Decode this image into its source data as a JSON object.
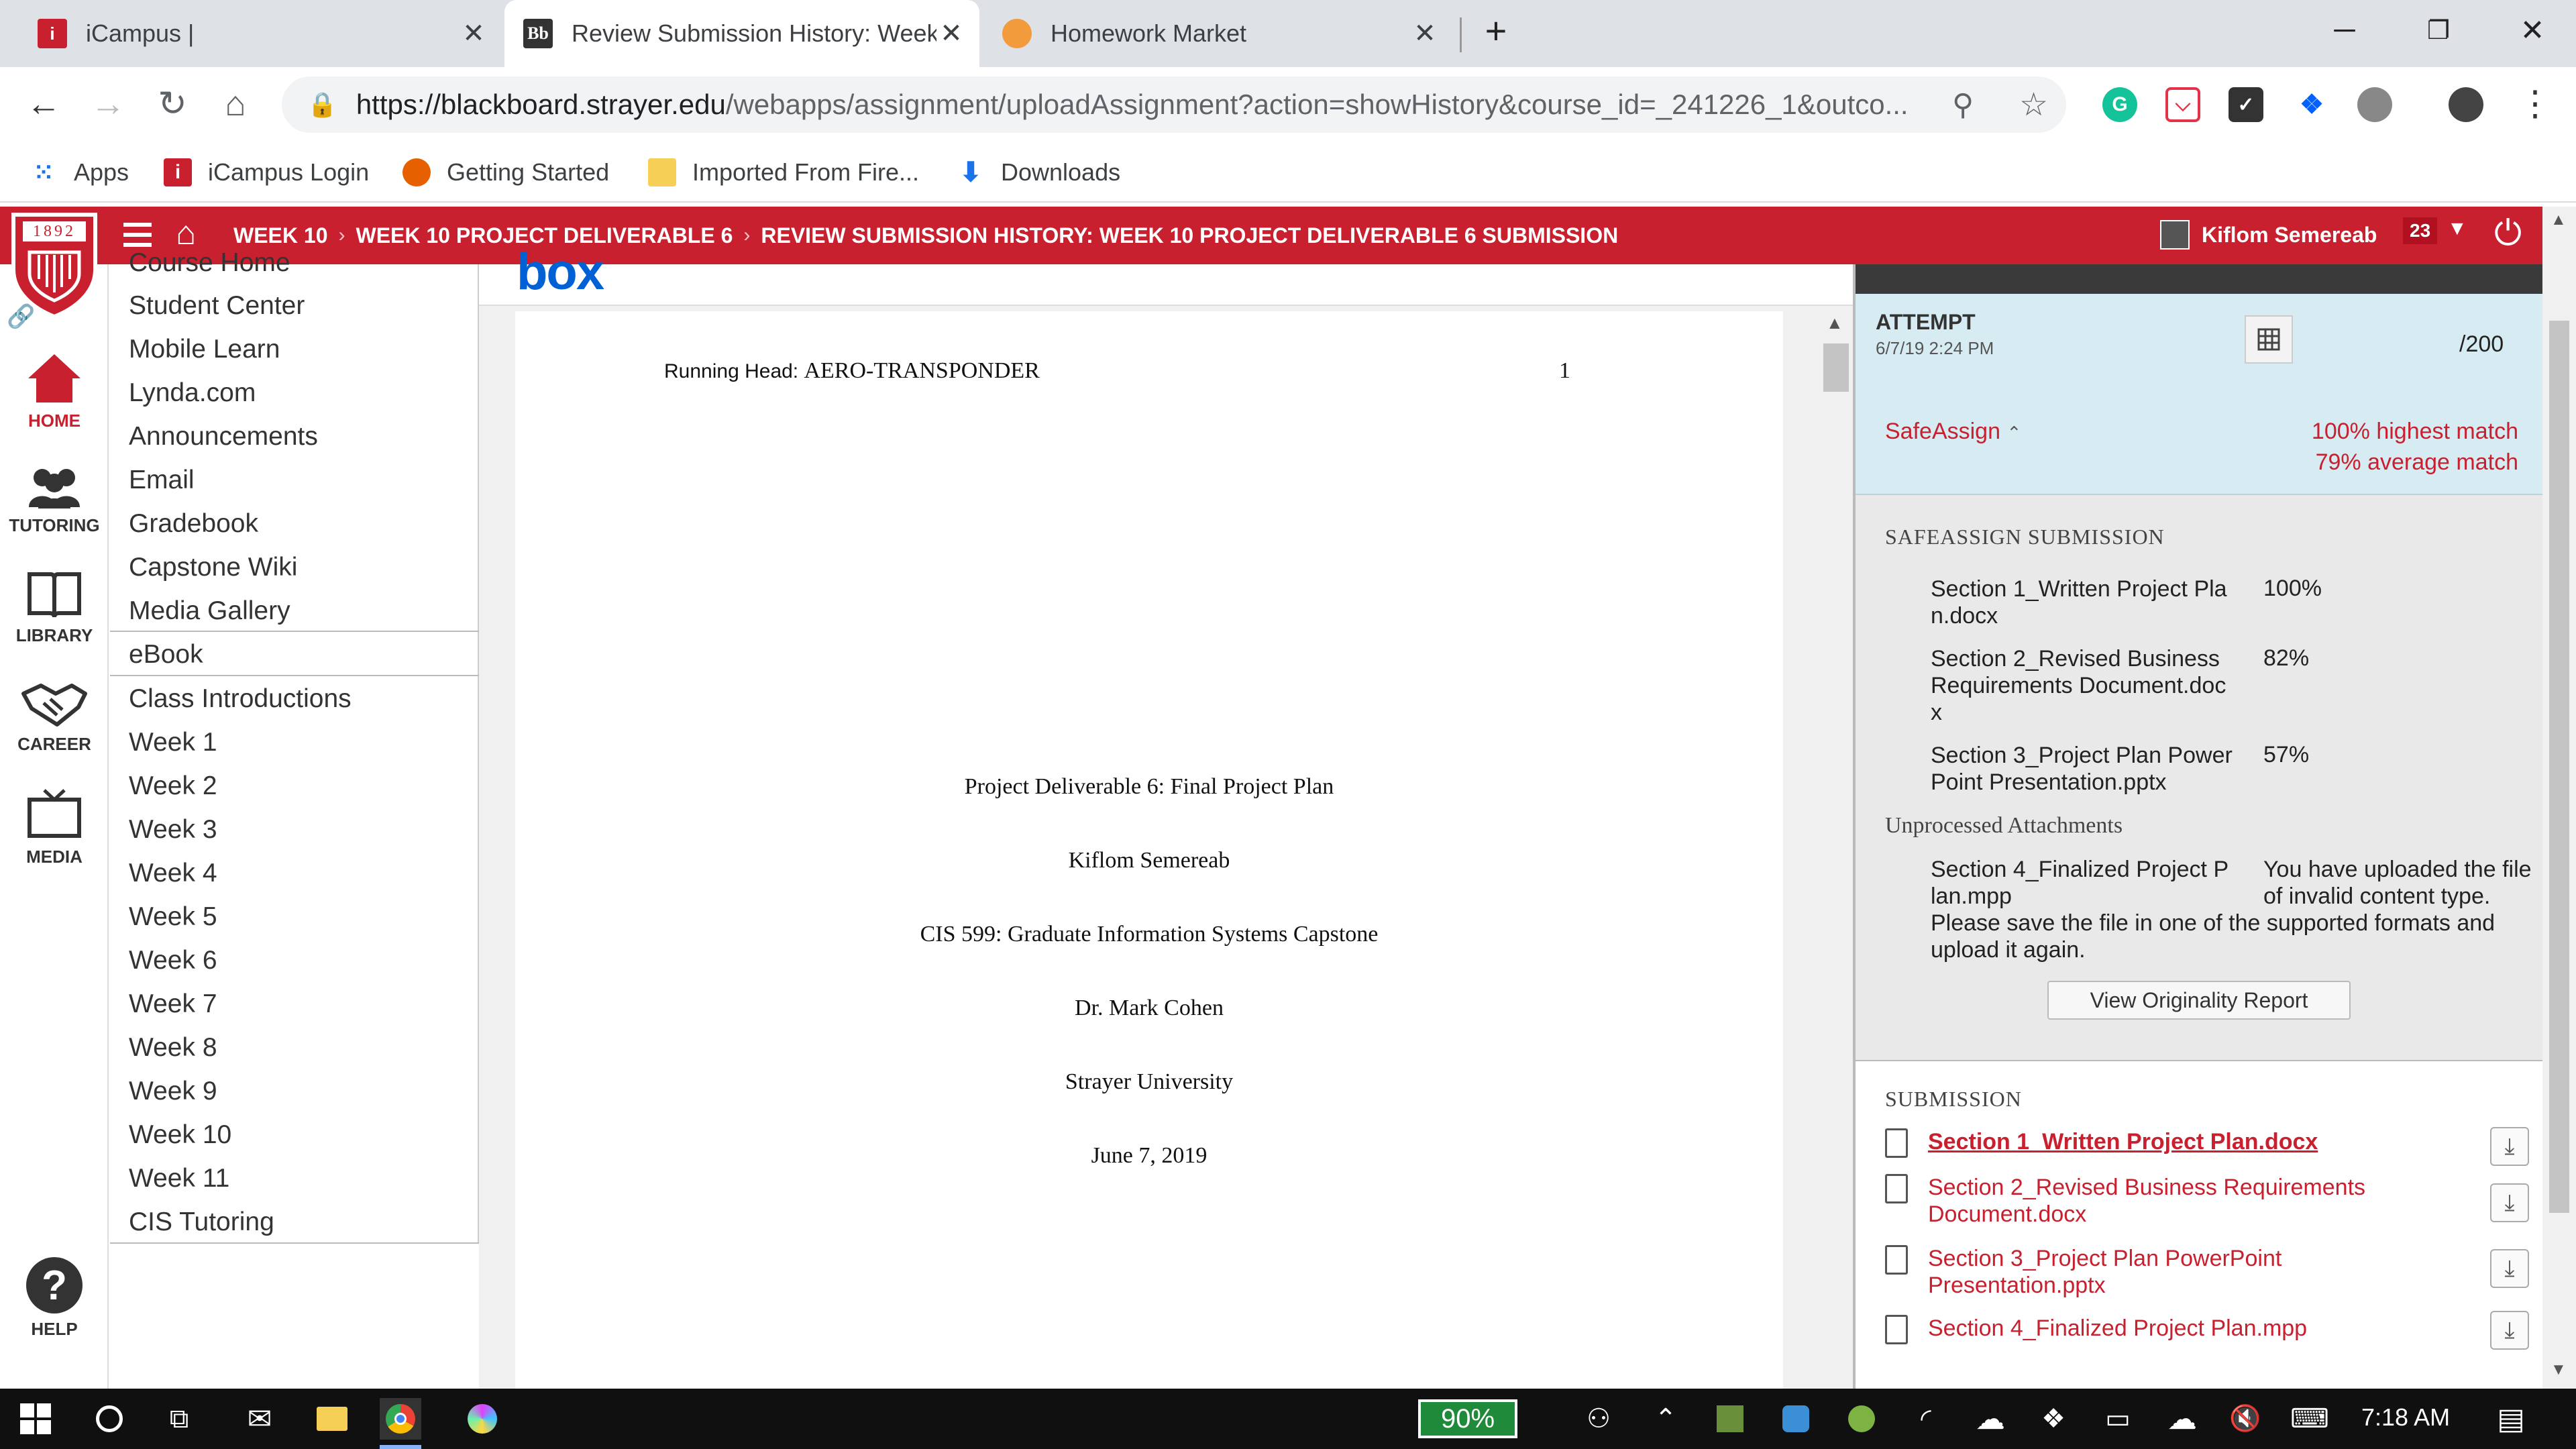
{
  "browser": {
    "tabs": [
      {
        "title": "iCampus |",
        "favicon": "icampus-icon"
      },
      {
        "title": "Review Submission History: Week",
        "favicon": "blackboard-icon",
        "active": true
      },
      {
        "title": "Homework Market",
        "favicon": "homework-market-icon"
      }
    ],
    "url_host": "https://blackboard.strayer.edu",
    "url_path": "/webapps/assignment/uploadAssignment?action=showHistory&course_id=_241226_1&outco...",
    "extension_badge": "1",
    "bookmarks": [
      {
        "label": "Apps",
        "icon": "apps-grid-icon"
      },
      {
        "label": "iCampus Login",
        "icon": "icampus-icon"
      },
      {
        "label": "Getting Started",
        "icon": "firefox-icon"
      },
      {
        "label": "Imported From Fire...",
        "icon": "folder-icon"
      },
      {
        "label": "Downloads",
        "icon": "download-icon"
      }
    ]
  },
  "header": {
    "logo_year": "1892",
    "breadcrumbs": [
      "WEEK 10",
      "WEEK 10 PROJECT DELIVERABLE 6",
      "REVIEW SUBMISSION HISTORY: WEEK 10 PROJECT DELIVERABLE 6 SUBMISSION"
    ],
    "user_name": "Kiflom Semereab",
    "notification_count": "23",
    "accent": "#c8202e"
  },
  "rail": [
    {
      "label": "HOME",
      "icon": "home-icon"
    },
    {
      "label": "TUTORING",
      "icon": "people-icon"
    },
    {
      "label": "LIBRARY",
      "icon": "book-icon"
    },
    {
      "label": "CAREER",
      "icon": "handshake-icon"
    },
    {
      "label": "MEDIA",
      "icon": "tv-icon"
    },
    {
      "label": "HELP",
      "icon": "help-icon"
    }
  ],
  "course_menu": {
    "partial_item": "Course Home",
    "items": [
      "Student Center",
      "Mobile Learn",
      "Lynda.com",
      "Announcements",
      "Email",
      "Gradebook",
      "Capstone Wiki",
      "Media Gallery",
      "eBook",
      "Class Introductions",
      "Week 1",
      "Week 2",
      "Week 3",
      "Week 4",
      "Week 5",
      "Week 6",
      "Week 7",
      "Week 8",
      "Week 9",
      "Week 10",
      "Week 11",
      "CIS Tutoring"
    ]
  },
  "document": {
    "viewer_logo": "box",
    "running_head": "Running Head: ",
    "running_head_title": "AERO-TRANSPONDER",
    "page_number": "1",
    "title": "Project Deliverable 6: Final Project Plan",
    "author": "Kiflom Semereab",
    "course": "CIS 599: Graduate Information Systems Capstone",
    "instructor": "Dr. Mark Cohen",
    "institution": "Strayer University",
    "date": "June 7, 2019"
  },
  "attempt": {
    "heading": "ATTEMPT",
    "datetime": "6/7/19 2:24 PM",
    "grade": "/200",
    "safeassign_label": "SafeAssign",
    "highest_match": "100% highest match",
    "average_match": "79% average match"
  },
  "safeassign": {
    "heading": "SAFEASSIGN SUBMISSION",
    "files": [
      {
        "name_line1": "Section 1_Written Project Pla",
        "name_line2": "n.docx",
        "name_line3": "",
        "pct": "100%"
      },
      {
        "name_line1": "Section 2_Revised Business",
        "name_line2": "Requirements Document.doc",
        "name_line3": "x",
        "pct": "82%"
      },
      {
        "name_line1": "Section 3_Project Plan Power",
        "name_line2": "Point Presentation.pptx",
        "name_line3": "",
        "pct": "57%"
      }
    ],
    "unprocessed_heading": "Unprocessed Attachments",
    "unprocessed_name_line1": "Section 4_Finalized Project P",
    "unprocessed_name_line2": "lan.mpp",
    "unprocessed_msg_line1": "You have uploaded the file",
    "unprocessed_msg_line2": "of invalid content type.",
    "unprocessed_msg_line3": "Please save the file in one of the supported formats and",
    "unprocessed_msg_line4": "upload it again.",
    "report_button": "View Originality Report"
  },
  "submission": {
    "heading": "SUBMISSION",
    "files": [
      {
        "line1": "Section 1_Written Project Plan.docx",
        "line2": ""
      },
      {
        "line1": "Section 2_Revised Business Requirements",
        "line2": "Document.docx"
      },
      {
        "line1": "Section 3_Project Plan PowerPoint",
        "line2": "Presentation.pptx"
      },
      {
        "line1": "Section 4_Finalized Project Plan.mpp",
        "line2": ""
      }
    ]
  },
  "taskbar": {
    "battery_percent": "90%",
    "clock": "7:18 AM"
  }
}
